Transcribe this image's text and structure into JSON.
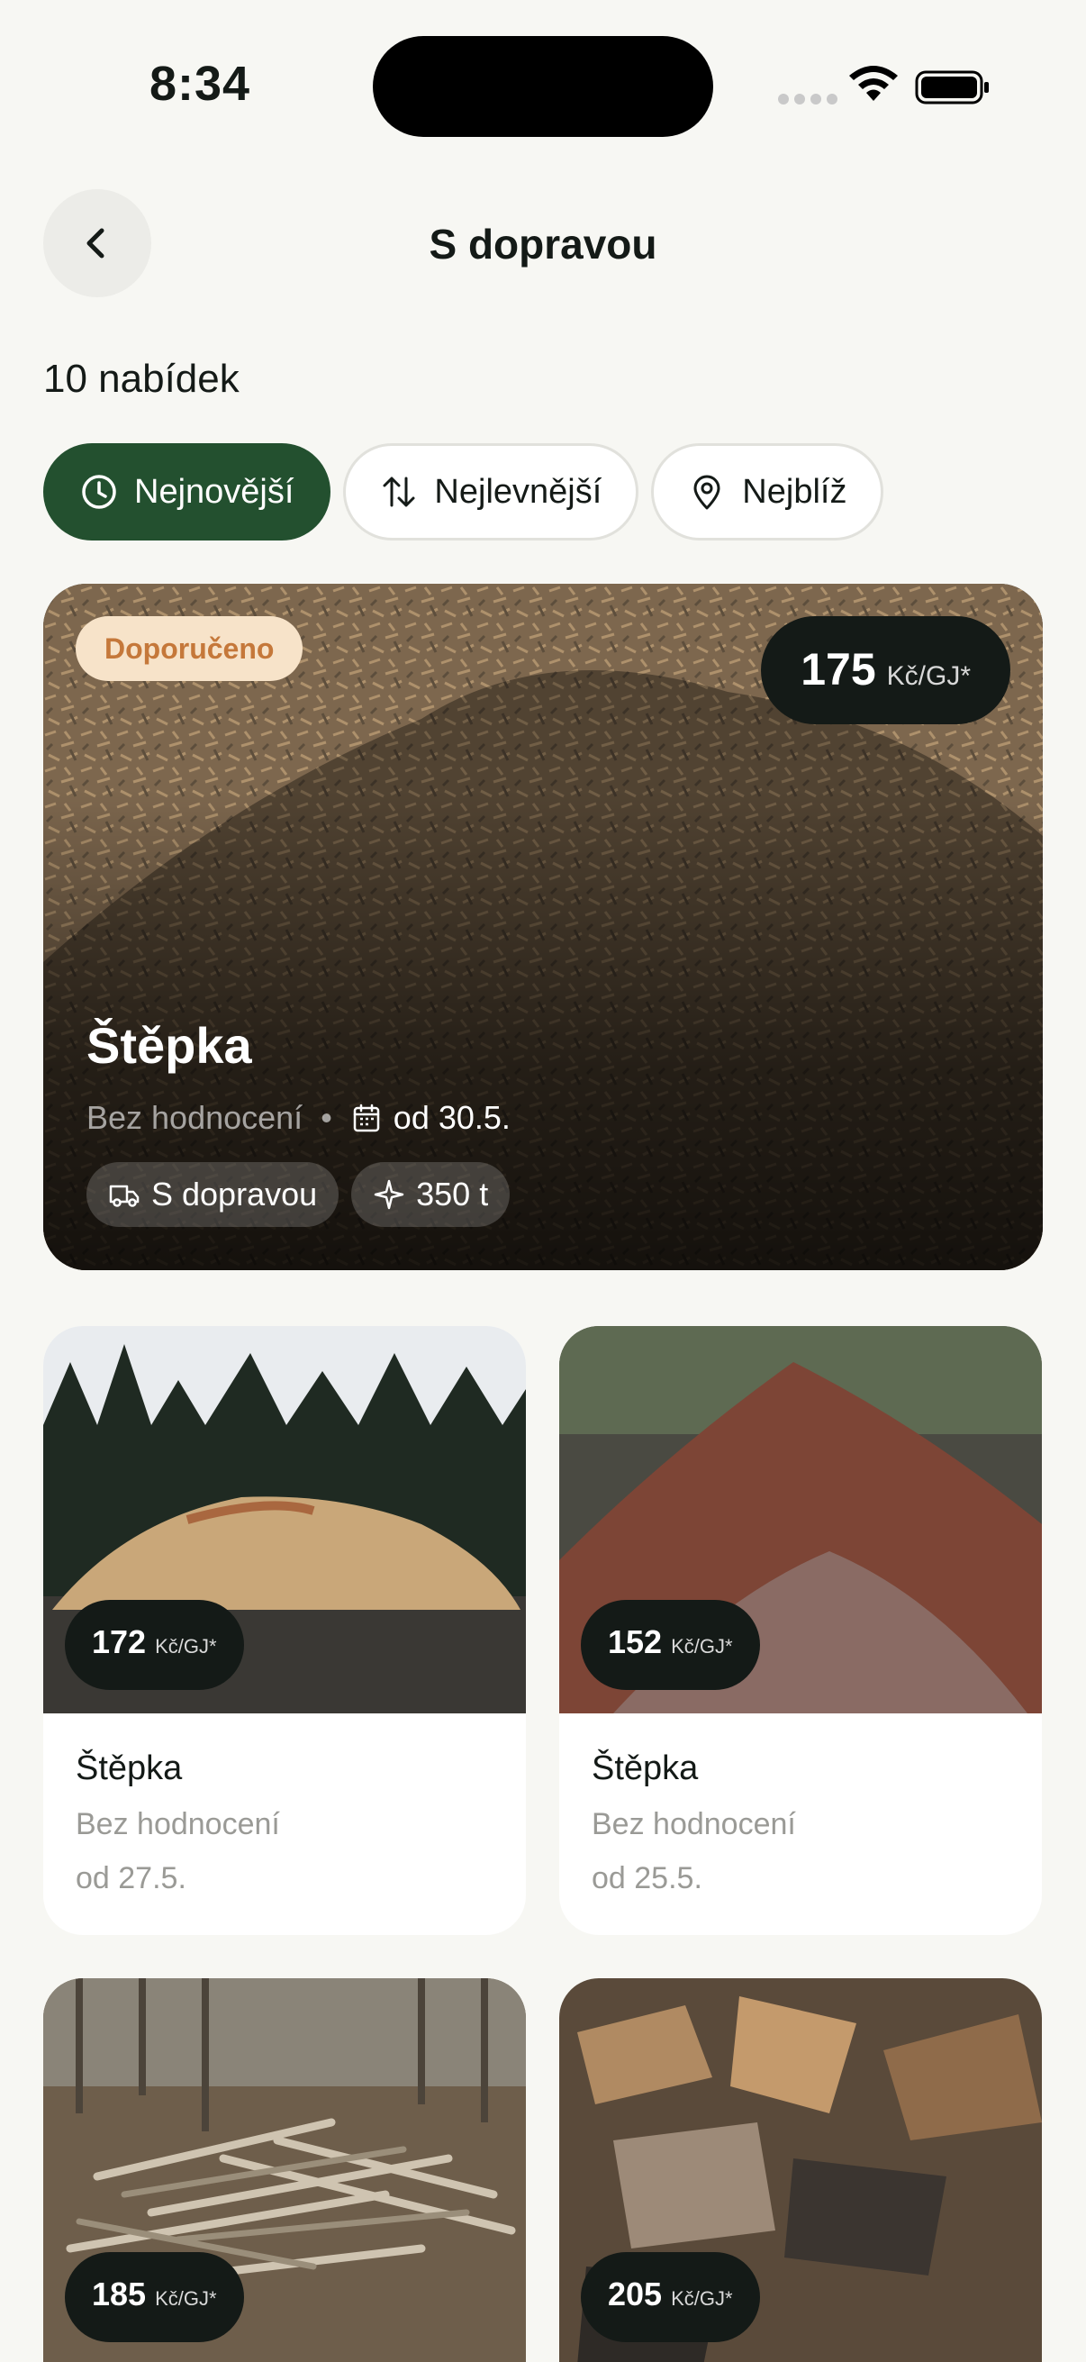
{
  "status_bar": {
    "time": "8:34"
  },
  "header": {
    "title": "S dopravou"
  },
  "results": {
    "count_label": "10 nabídek"
  },
  "filters": [
    {
      "label": "Nejnovější",
      "icon": "clock-icon",
      "active": true
    },
    {
      "label": "Nejlevnější",
      "icon": "sort-arrows-icon",
      "active": false
    },
    {
      "label": "Nejblíž",
      "icon": "location-pin-icon",
      "active": false
    }
  ],
  "featured": {
    "badge": "Doporučeno",
    "price": "175",
    "unit": "Kč/GJ*",
    "title": "Štěpka",
    "rating": "Bez hodnocení",
    "separator": "•",
    "date": "od 30.5.",
    "tags": [
      {
        "label": "S dopravou",
        "icon": "truck-icon"
      },
      {
        "label": "350 t",
        "icon": "sparkle-icon"
      }
    ]
  },
  "listings": [
    {
      "price": "172",
      "unit": "Kč/GJ*",
      "title": "Štěpka",
      "rating": "Bez hodnocení",
      "date": "od 27.5."
    },
    {
      "price": "152",
      "unit": "Kč/GJ*",
      "title": "Štěpka",
      "rating": "Bez hodnocení",
      "date": "od 25.5."
    },
    {
      "price": "185",
      "unit": "Kč/GJ*"
    },
    {
      "price": "205",
      "unit": "Kč/GJ*"
    }
  ],
  "colors": {
    "accent": "#23502f",
    "badge_bg": "#f7e3c9",
    "badge_text": "#c5783a",
    "pill_bg": "#141a17"
  }
}
